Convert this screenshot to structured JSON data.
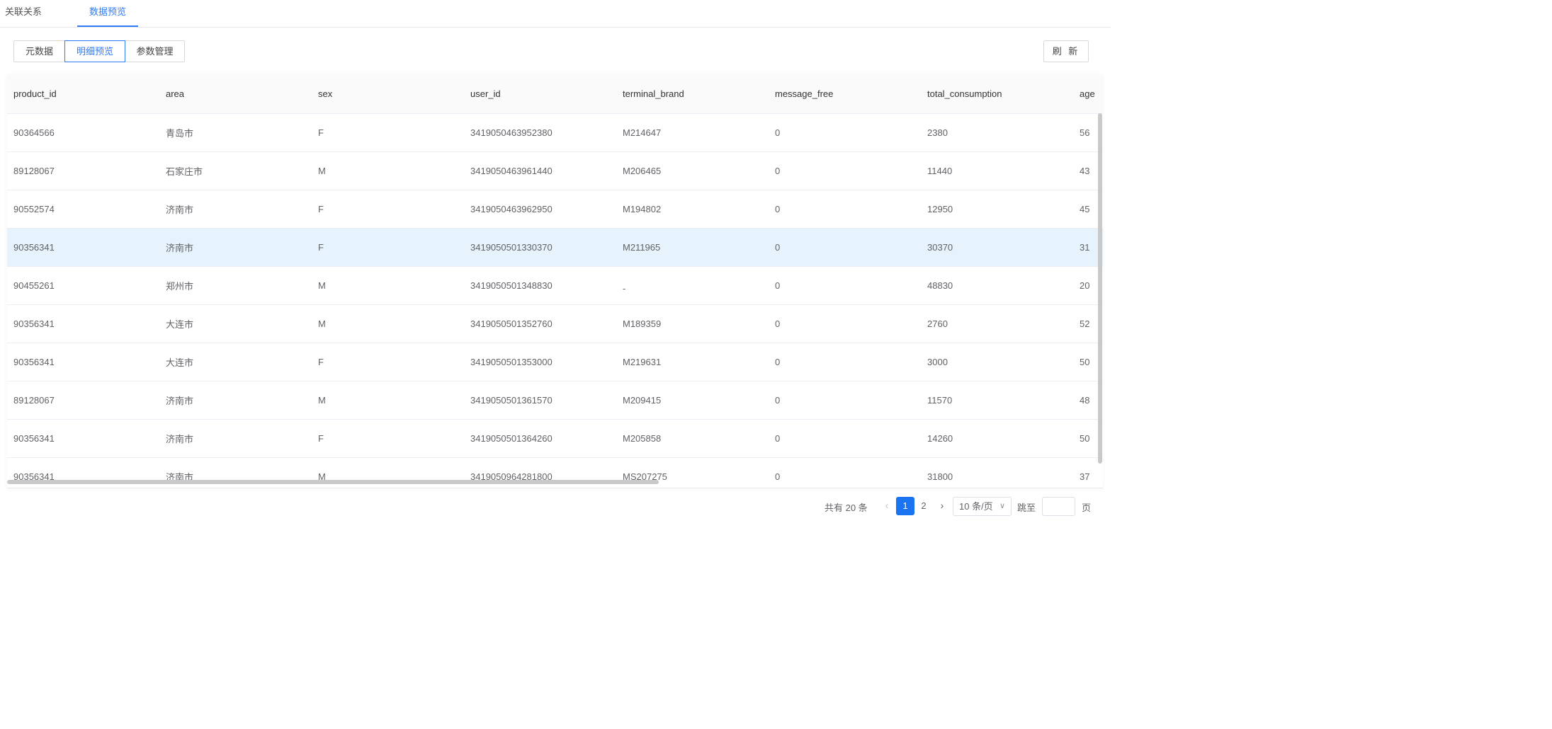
{
  "top_tabs": [
    "关联关系",
    "数据预览"
  ],
  "segments": [
    "元数据",
    "明细预览",
    "参数管理"
  ],
  "refresh_label": "刷 新",
  "table": {
    "columns": [
      "product_id",
      "area",
      "sex",
      "user_id",
      "terminal_brand",
      "message_free",
      "total_consumption",
      "age"
    ],
    "rows": [
      [
        "90364566",
        "青岛市",
        "F",
        "3419050463952380",
        "M214647",
        "0",
        "2380",
        "56"
      ],
      [
        "89128067",
        "石家庄市",
        "M",
        "3419050463961440",
        "M206465",
        "0",
        "11440",
        "43"
      ],
      [
        "90552574",
        "济南市",
        "F",
        "3419050463962950",
        "M194802",
        "0",
        "12950",
        "45"
      ],
      [
        "90356341",
        "济南市",
        "F",
        "3419050501330370",
        "M211965",
        "0",
        "30370",
        "31"
      ],
      [
        "90455261",
        "郑州市",
        "M",
        "3419050501348830",
        "-",
        "0",
        "48830",
        "20"
      ],
      [
        "90356341",
        "大连市",
        "M",
        "3419050501352760",
        "M189359",
        "0",
        "2760",
        "52"
      ],
      [
        "90356341",
        "大连市",
        "F",
        "3419050501353000",
        "M219631",
        "0",
        "3000",
        "50"
      ],
      [
        "89128067",
        "济南市",
        "M",
        "3419050501361570",
        "M209415",
        "0",
        "11570",
        "48"
      ],
      [
        "90356341",
        "济南市",
        "F",
        "3419050501364260",
        "M205858",
        "0",
        "14260",
        "50"
      ],
      [
        "90356341",
        "济南市",
        "M",
        "3419050964281800",
        "MS207275",
        "0",
        "31800",
        "37"
      ]
    ],
    "highlighted_row": 3
  },
  "pagination": {
    "total_text": "共有 20 条",
    "pages": [
      "1",
      "2"
    ],
    "current_page": "1",
    "page_size": "10 条/页",
    "jump_label": "跳至",
    "page_suffix": "页",
    "prev_icon": "chevron-left-icon",
    "next_icon": "chevron-right-icon"
  },
  "colors": {
    "accent": "#2f7bf5",
    "active_page_bg": "#1a73f0",
    "row_highlight": "#e6f2fc"
  }
}
